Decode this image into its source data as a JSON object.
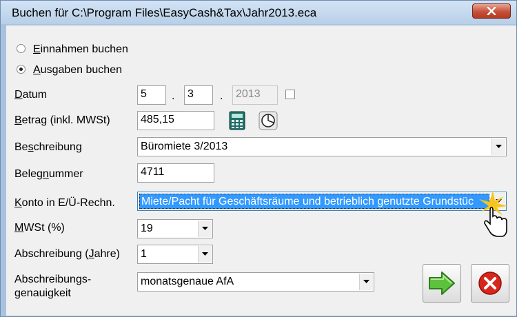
{
  "window": {
    "title": "Buchen für C:\\Program Files\\EasyCash&Tax\\Jahr2013.eca"
  },
  "booking_type": {
    "options": [
      {
        "label_accel": "E",
        "label_rest": "innahmen buchen",
        "selected": false
      },
      {
        "label_accel": "A",
        "label_rest": "usgaben buchen",
        "selected": true
      }
    ]
  },
  "datum": {
    "label_accel": "D",
    "label_rest": "atum",
    "day": "5",
    "month": "3",
    "year": "2013",
    "sep1": ".",
    "sep2": "."
  },
  "betrag": {
    "label_accel": "B",
    "label_rest": "etrag (inkl. MWSt)",
    "value": "485,15",
    "calculator_icon": "calculator-icon",
    "pie_icon": "pie-chart-icon"
  },
  "beschreibung": {
    "label_pre": "Be",
    "label_accel": "s",
    "label_rest": "chreibung",
    "value": "Büromiete 3/2013"
  },
  "belegnummer": {
    "label_pre": "Beleg",
    "label_accel": "n",
    "label_rest": "ummer",
    "value": "4711"
  },
  "konto": {
    "label_accel": "K",
    "label_rest": "onto in E/Ü-Rechn.",
    "value": "Miete/Pacht für Geschäftsräume und betrieblich genutzte Grundstüc"
  },
  "mwst": {
    "label_accel": "M",
    "label_rest": "WSt (%)",
    "value": "19"
  },
  "abschreibung": {
    "label_pre": "Abschreibung (",
    "label_accel": "J",
    "label_rest": "ahre)",
    "value": "1"
  },
  "abschreibungsgenauigkeit": {
    "label_line1": "Abschreibungs-",
    "label_line2": "genauigkeit",
    "value": "monatsgenaue AfA"
  },
  "buttons": {
    "ok_icon": "green-arrow-right-icon",
    "cancel_icon": "red-x-icon"
  },
  "colors": {
    "selection": "#3399ff",
    "ok_green": "#5cc23c",
    "cancel_red": "#d8261c"
  }
}
